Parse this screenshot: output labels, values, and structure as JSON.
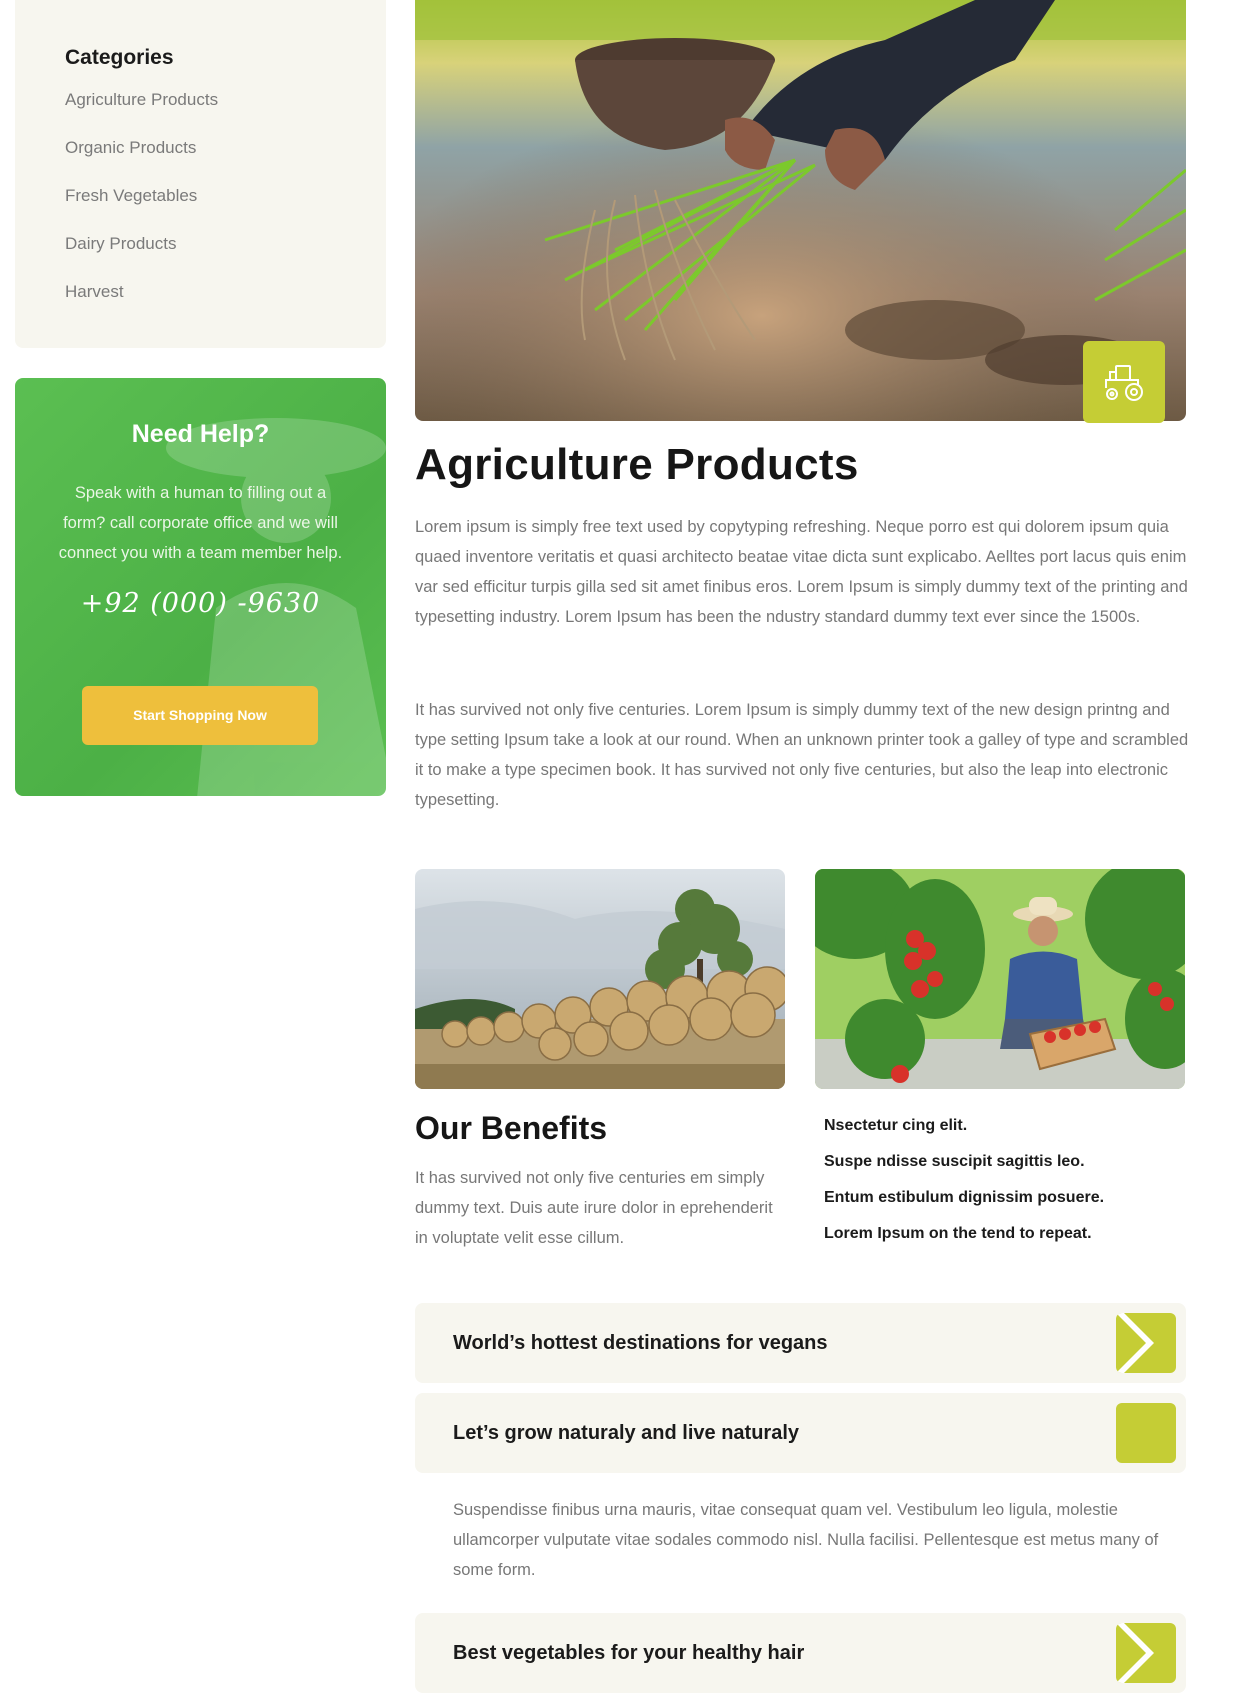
{
  "sidebar": {
    "categories_title": "Categories",
    "categories": [
      "Agriculture Products",
      "Organic Products",
      "Fresh Vegetables",
      "Dairy Products",
      "Harvest"
    ],
    "help": {
      "title": "Need Help?",
      "text": "Speak with a human to filling out a form? call corporate office and we will connect you with a team member help.",
      "phone": "+92 (000) -9630",
      "button": "Start Shopping Now"
    }
  },
  "main": {
    "title": "Agriculture Products",
    "paragraph1": "Lorem ipsum is simply free text used by copytyping refreshing. Neque porro est qui dolorem ipsum quia quaed inventore veritatis et quasi architecto beatae vitae dicta sunt explicabo. Aelltes port lacus quis enim var sed efficitur turpis gilla sed sit amet finibus eros. Lorem Ipsum is simply dummy text of the printing and typesetting industry. Lorem Ipsum has been the ndustry standard dummy text ever since the 1500s.",
    "paragraph2": "It has survived not only five centuries. Lorem Ipsum is simply dummy text of the new design printng and type setting Ipsum take a look at our round. When an unknown printer took a galley of type and scrambled it to make a type specimen book. It has survived not only five centuries, but also the leap into electronic typesetting.",
    "benefits": {
      "title": "Our Benefits",
      "text": "It has survived not only five centuries em simply dummy text. Duis aute irure dolor in eprehenderit in voluptate velit esse cillum.",
      "list": [
        "Nsectetur cing elit.",
        "Suspe ndisse suscipit sagittis leo.",
        "Entum estibulum dignissim posuere.",
        "Lorem Ipsum on the tend to repeat."
      ]
    },
    "faq": [
      {
        "question": "World’s hottest destinations for vegans",
        "open": false
      },
      {
        "question": "Let’s grow naturaly and live naturaly",
        "open": true,
        "answer": "Suspendisse finibus urna mauris, vitae consequat quam vel. Vestibulum leo ligula, molestie ullamcorper vulputate vitae sodales commodo nisl. Nulla facilisi. Pellentesque est metus many of some form."
      },
      {
        "question": "Best vegetables for your healthy hair",
        "open": false
      }
    ]
  },
  "colors": {
    "accent_lime": "#c5cd35",
    "help_green": "#4cb046",
    "button_yellow": "#eebf3c",
    "panel_beige": "#f7f6ef"
  },
  "icons": [
    "tractor-icon",
    "chevron-right-icon"
  ]
}
